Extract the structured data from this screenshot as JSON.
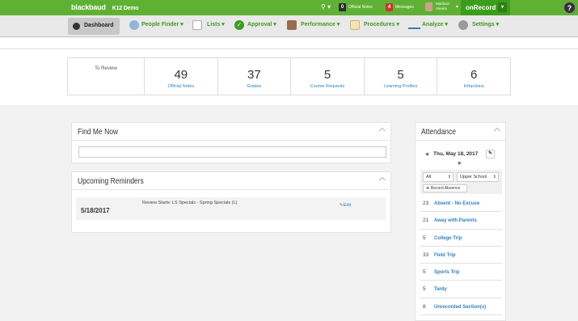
{
  "topbar": {
    "brand": "blackbaud",
    "school": "K12 Demo",
    "search_icon": "search-icon",
    "notes_count": "0",
    "notes_label": "Official Notes",
    "messages_count": "4",
    "messages_label": "Messages",
    "user_name_1": "Madison",
    "user_name_2": "Akeela",
    "onrecord": "onRecord",
    "help": "?"
  },
  "nav": {
    "dashboard": "Dashboard",
    "people_finder": "People Finder",
    "lists": "Lists",
    "approval": "Approval",
    "performance": "Performance",
    "procedures": "Procedures",
    "analyze": "Analyze",
    "settings": "Settings"
  },
  "stats": {
    "label": "To Review",
    "items": [
      {
        "value": "49",
        "label": "Official Notes"
      },
      {
        "value": "37",
        "label": "Grades"
      },
      {
        "value": "5",
        "label": "Course Requests"
      },
      {
        "value": "5",
        "label": "Learning Profiles"
      },
      {
        "value": "6",
        "label": "Infractions"
      }
    ]
  },
  "find_me": {
    "title": "Find Me Now",
    "value": ""
  },
  "reminders": {
    "title": "Upcoming Reminders",
    "rows": [
      {
        "date": "5/18/2017",
        "text": "Review Starts: LS Specials - Spring Specials (L)",
        "edit": "Edit"
      }
    ]
  },
  "attendance": {
    "title": "Attendance",
    "date": "Thu, May 18, 2017",
    "filter_all": "All",
    "filter_school": "Upper School",
    "record_absence": "Record Absence",
    "items": [
      {
        "count": "23",
        "label": "Absent - No Excuse"
      },
      {
        "count": "21",
        "label": "Away with Parents"
      },
      {
        "count": "5",
        "label": "College Trip"
      },
      {
        "count": "33",
        "label": "Field Trip"
      },
      {
        "count": "5",
        "label": "Sports Trip"
      },
      {
        "count": "5",
        "label": "Tardy"
      },
      {
        "count": "8",
        "label": "Unrecorded Section(s)"
      }
    ]
  },
  "colors": {
    "brand_green": "#5fb133",
    "link_blue": "#2e7fc0"
  }
}
